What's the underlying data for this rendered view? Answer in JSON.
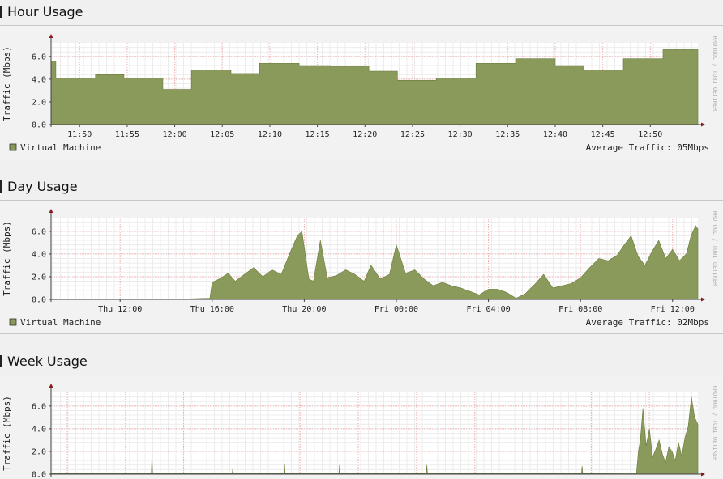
{
  "colors": {
    "area_fill": "#8a9a5b",
    "area_stroke": "#6b7a3f",
    "grid": "#f1b0b0",
    "axis": "#404040",
    "plot_bg": "#ffffff",
    "watermark": "#b0b0b0"
  },
  "watermark": "RRDTOOL / TOBI OETIKER",
  "chart_data": [
    {
      "type": "area",
      "section_title": "Hour Usage",
      "title": "",
      "ylabel": "Traffic (Mbps)",
      "xlabel": "",
      "ylim": [
        0,
        7.2
      ],
      "yticks": [
        0,
        2,
        4,
        6
      ],
      "ytick_labels": [
        "0.0",
        "2.0",
        "4.0",
        "6.0"
      ],
      "xlim": [
        11.7833,
        12.9167
      ],
      "xticks": [
        11.8333,
        11.9167,
        12.0,
        12.0833,
        12.1667,
        12.25,
        12.3333,
        12.4167,
        12.5,
        12.5833,
        12.6667,
        12.75,
        12.8333
      ],
      "xtick_labels": [
        "11:50",
        "11:55",
        "12:00",
        "12:05",
        "12:10",
        "12:15",
        "12:20",
        "12:25",
        "12:30",
        "12:35",
        "12:40",
        "12:45",
        "12:50"
      ],
      "step": true,
      "x": [
        11.7833,
        11.7917,
        11.8611,
        11.9111,
        11.9792,
        12.0292,
        12.0986,
        12.1486,
        12.2181,
        12.2722,
        12.3403,
        12.3903,
        12.4583,
        12.5278,
        12.5972,
        12.6667,
        12.7167,
        12.7861,
        12.8556,
        12.9167
      ],
      "values": [
        5.6,
        4.1,
        4.4,
        4.1,
        3.1,
        4.8,
        4.5,
        5.4,
        5.2,
        5.1,
        4.7,
        3.9,
        4.1,
        5.4,
        5.8,
        5.2,
        4.8,
        5.8,
        6.6,
        6.6
      ],
      "grid": true,
      "legend": [
        {
          "name": "Virtual Machine"
        }
      ],
      "legend_position": "bottom-left",
      "average_label": "Average Traffic:",
      "average_value": "05Mbps"
    },
    {
      "type": "area",
      "section_title": "Day Usage",
      "title": "",
      "ylabel": "Traffic (Mbps)",
      "xlabel": "",
      "ylim": [
        0,
        7.2
      ],
      "yticks": [
        0,
        2,
        4,
        6
      ],
      "ytick_labels": [
        "0.0",
        "2.0",
        "4.0",
        "6.0"
      ],
      "xlim": [
        9.0,
        37.1
      ],
      "xticks": [
        12,
        16,
        20,
        24,
        28,
        32,
        36
      ],
      "xtick_labels": [
        "Thu 12:00",
        "Thu 16:00",
        "Thu 20:00",
        "Fri 00:00",
        "Fri 04:00",
        "Fri 08:00",
        "Fri 12:00"
      ],
      "step": false,
      "x": [
        9.0,
        10.0,
        11.0,
        12.0,
        13.0,
        14.0,
        15.0,
        15.9,
        16.0,
        16.3,
        16.7,
        17.0,
        17.4,
        17.8,
        18.2,
        18.6,
        19.0,
        19.4,
        19.7,
        19.9,
        20.2,
        20.4,
        20.7,
        21.0,
        21.4,
        21.8,
        22.2,
        22.6,
        22.9,
        23.3,
        23.7,
        24.0,
        24.4,
        24.8,
        25.2,
        25.6,
        26.0,
        26.4,
        26.8,
        27.2,
        27.6,
        28.0,
        28.4,
        28.8,
        29.2,
        29.6,
        30.0,
        30.4,
        30.8,
        31.2,
        31.6,
        32.0,
        32.4,
        32.8,
        33.2,
        33.6,
        33.9,
        34.2,
        34.5,
        34.8,
        35.1,
        35.4,
        35.7,
        36.0,
        36.3,
        36.6,
        36.8,
        37.0,
        37.1
      ],
      "values": [
        0.05,
        0.05,
        0.05,
        0.05,
        0.05,
        0.05,
        0.05,
        0.1,
        1.5,
        1.8,
        2.3,
        1.6,
        2.2,
        2.8,
        2.0,
        2.6,
        2.2,
        4.2,
        5.6,
        6.0,
        1.8,
        1.6,
        5.2,
        1.9,
        2.1,
        2.6,
        2.2,
        1.6,
        3.0,
        1.8,
        2.2,
        4.8,
        2.3,
        2.6,
        1.8,
        1.2,
        1.5,
        1.2,
        1.0,
        0.7,
        0.4,
        0.9,
        0.9,
        0.6,
        0.1,
        0.5,
        1.3,
        2.2,
        1.0,
        1.2,
        1.4,
        1.9,
        2.8,
        3.6,
        3.4,
        3.9,
        4.8,
        5.6,
        3.8,
        3.0,
        4.2,
        5.2,
        3.6,
        4.4,
        3.4,
        4.0,
        5.6,
        6.5,
        6.2
      ],
      "grid": true,
      "legend": [
        {
          "name": "Virtual Machine"
        }
      ],
      "legend_position": "bottom-left",
      "average_label": "Average Traffic:",
      "average_value": "02Mbps"
    },
    {
      "type": "area",
      "section_title": "Week Usage",
      "title": "",
      "ylabel": "Traffic (Mbps)",
      "xlabel": "",
      "ylim": [
        0,
        7.2
      ],
      "yticks": [
        0,
        2,
        4,
        6
      ],
      "ytick_labels": [
        "0.0",
        "2.0",
        "4.0",
        "6.0"
      ],
      "xlim": [
        0,
        100
      ],
      "xticks": [],
      "xtick_labels": [],
      "step": false,
      "x": [
        0,
        15.5,
        15.6,
        15.7,
        28.0,
        28.1,
        28.2,
        36.0,
        36.1,
        36.2,
        44.5,
        44.6,
        44.7,
        58.0,
        58.1,
        58.2,
        82.0,
        82.1,
        82.2,
        90.5,
        90.8,
        91.1,
        91.5,
        92.0,
        92.5,
        93.0,
        93.5,
        94.0,
        94.5,
        95.0,
        95.5,
        96.0,
        96.5,
        97.0,
        97.5,
        98.0,
        98.5,
        99.0,
        99.5,
        100
      ],
      "values": [
        0.05,
        0.05,
        1.6,
        0.05,
        0.05,
        0.5,
        0.05,
        0.05,
        0.9,
        0.05,
        0.05,
        0.8,
        0.05,
        0.05,
        0.8,
        0.05,
        0.05,
        0.7,
        0.05,
        0.1,
        2.0,
        3.0,
        5.8,
        2.5,
        4.0,
        1.5,
        2.2,
        3.0,
        1.8,
        1.0,
        2.4,
        2.0,
        1.2,
        2.8,
        1.6,
        3.2,
        4.2,
        6.8,
        5.0,
        4.4
      ],
      "grid": true,
      "legend": [],
      "legend_position": "bottom-left",
      "average_label": "",
      "average_value": ""
    }
  ]
}
